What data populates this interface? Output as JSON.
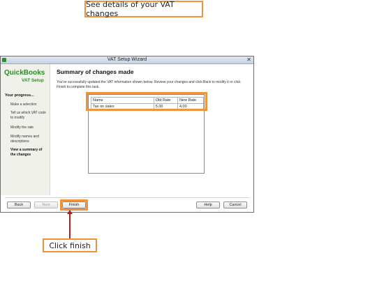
{
  "callouts": {
    "top": "See details of your VAT changes",
    "bottom": "Click finish"
  },
  "window": {
    "title": "VAT Setup Wizard",
    "close_glyph": "✕"
  },
  "sidebar": {
    "logo": "QuickBooks",
    "subtitle": "VAT Setup",
    "progress_title": "Your progress...",
    "steps": [
      {
        "label": "Make a selection"
      },
      {
        "label": "Tell us which VAT code to modify"
      },
      {
        "label": "Modify the rate"
      },
      {
        "label": "Modify names and descriptions"
      },
      {
        "label": "View a summary of the changes"
      }
    ]
  },
  "main": {
    "title": "Summary of changes made",
    "description": "You've successfully updated the VAT information shown below. Review your changes and click Back to modify it or click Finish to complete this task.",
    "table": {
      "columns": [
        "Name",
        "Old Rate",
        "New Rate"
      ],
      "rows": [
        [
          "Tax on sales",
          "5.00",
          "4.00"
        ]
      ]
    }
  },
  "buttons": {
    "back": "Back",
    "next": "Next",
    "finish": "Finish",
    "help": "Help",
    "cancel": "Cancel"
  }
}
